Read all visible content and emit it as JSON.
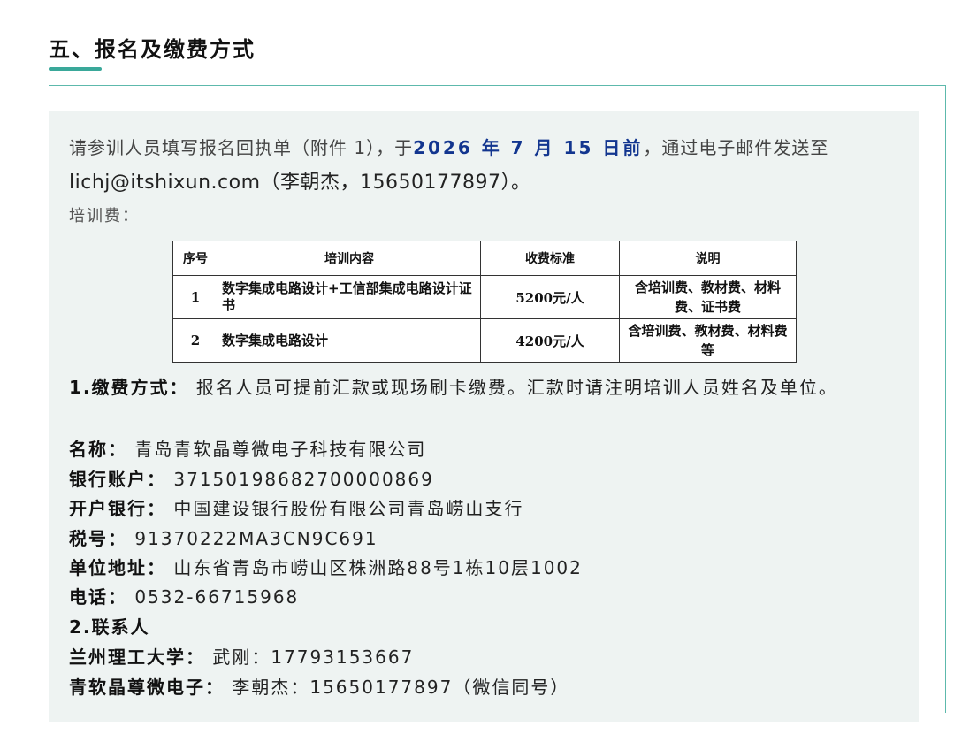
{
  "section": {
    "title": "五、报名及缴费方式"
  },
  "intro": {
    "text_before": "请参训人员填写报名回执单（附件 1），于",
    "deadline": "2026 年 7 月 15 日前",
    "text_after": "，通过电子邮件发送至",
    "email_contact": " lichj@itshixun.com（李朝杰，15650177897）。"
  },
  "fee_label": "培训费：",
  "fee_table": {
    "headers": [
      "序号",
      "培训内容",
      "收费标准",
      "说明"
    ],
    "rows": [
      {
        "seq": "1",
        "content": "数字集成电路设计+工信部集成电路设计证书",
        "price": "5200元/人",
        "note": "含培训费、教材费、材料费、证书费"
      },
      {
        "seq": "2",
        "content": "数字集成电路设计",
        "price": "4200元/人",
        "note": "含培训费、教材费、材料费等"
      }
    ]
  },
  "payment": {
    "label": "1.缴费方式：",
    "text": " 报名人员可提前汇款或现场刷卡缴费。汇款时请注明培训人员姓名及单位。"
  },
  "company_name": {
    "label": "名称：",
    "value": " 青岛青软晶尊微电子科技有限公司"
  },
  "bank_account": {
    "label": "银行账户：",
    "value": " 371501986827000008​69"
  },
  "bank": {
    "label": "开户银行：",
    "value": " 中国建设银行股份有限公司青岛崂山支行"
  },
  "tax_id": {
    "label": "税号：",
    "value": " 91370222MA3CN9C691"
  },
  "address": {
    "label": "单位地址：",
    "value": " 山东省青岛市崂山区株洲路88号1栋10层1002"
  },
  "phone": {
    "label": "电话：",
    "value": " 0532-66715968"
  },
  "contacts": {
    "heading": "2.联系人",
    "items": [
      {
        "org": "兰州理工大学：",
        "person": " 武刚：17793153667"
      },
      {
        "org": "青软晶尊微电子：",
        "person": " 李朝杰：15650177897（微信同号）"
      }
    ]
  }
}
